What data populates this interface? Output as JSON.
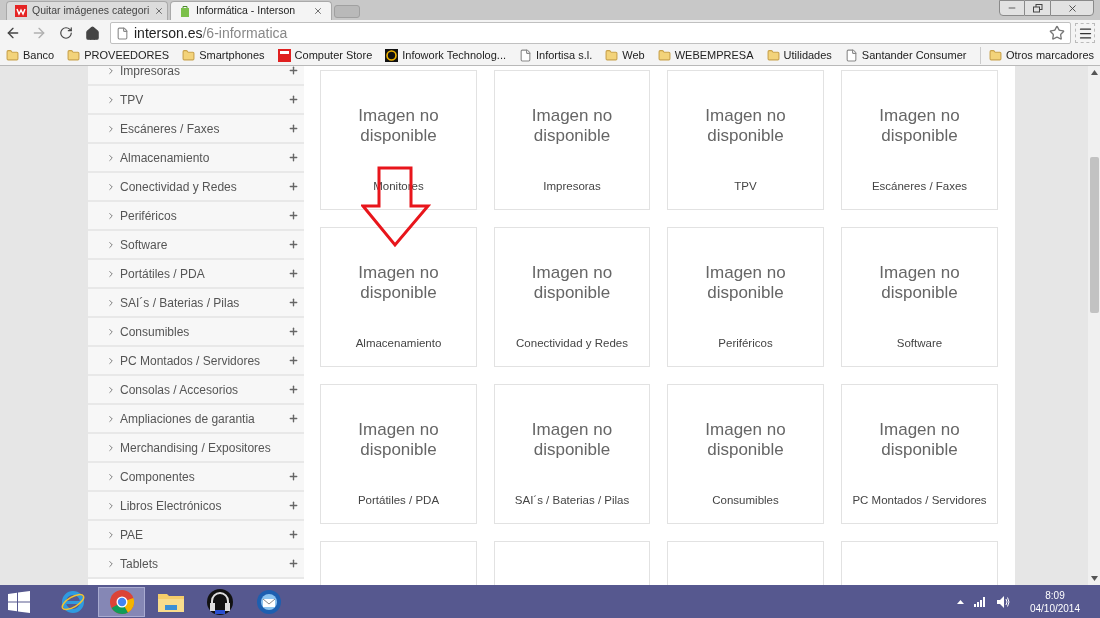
{
  "browser": {
    "tabs": [
      {
        "title": "Quitar imágenes categori",
        "selected": false,
        "kind": "red"
      },
      {
        "title": "Informática - Interson",
        "selected": true,
        "kind": "green"
      }
    ],
    "address": {
      "host": "interson.es",
      "path": "/6-informatica"
    },
    "bookmarks": [
      {
        "label": "Banco",
        "kind": "folder"
      },
      {
        "label": "PROVEEDORES",
        "kind": "folder"
      },
      {
        "label": "Smartphones",
        "kind": "folder"
      },
      {
        "label": "Computer Store",
        "kind": "red-logo"
      },
      {
        "label": "Infowork Technolog...",
        "kind": "round-logo"
      },
      {
        "label": "Infortisa s.l.",
        "kind": "page"
      },
      {
        "label": "Web",
        "kind": "folder"
      },
      {
        "label": "WEBEMPRESA",
        "kind": "folder"
      },
      {
        "label": "Utilidades",
        "kind": "folder"
      },
      {
        "label": "Santander Consumer",
        "kind": "page"
      }
    ],
    "other_bookmarks": "Otros marcadores"
  },
  "sidebar": {
    "items": [
      {
        "label": "Impresoras",
        "expandable": true
      },
      {
        "label": "TPV",
        "expandable": true
      },
      {
        "label": "Escáneres / Faxes",
        "expandable": true
      },
      {
        "label": "Almacenamiento",
        "expandable": true
      },
      {
        "label": "Conectividad y Redes",
        "expandable": true
      },
      {
        "label": "Periféricos",
        "expandable": true
      },
      {
        "label": "Software",
        "expandable": true
      },
      {
        "label": "Portátiles / PDA",
        "expandable": true
      },
      {
        "label": "SAI´s / Baterias / Pilas",
        "expandable": true
      },
      {
        "label": "Consumibles",
        "expandable": true
      },
      {
        "label": "PC Montados / Servidores",
        "expandable": true
      },
      {
        "label": "Consolas / Accesorios",
        "expandable": true
      },
      {
        "label": "Ampliaciones de garantia",
        "expandable": true
      },
      {
        "label": "Merchandising / Expositores",
        "expandable": false
      },
      {
        "label": "Componentes",
        "expandable": true
      },
      {
        "label": "Libros Electrónicos",
        "expandable": true
      },
      {
        "label": "PAE",
        "expandable": true
      },
      {
        "label": "Tablets",
        "expandable": true
      }
    ]
  },
  "grid": {
    "cards": [
      {
        "kind": "category",
        "image_text": "Imagen no disponible",
        "label": "Monitores"
      },
      {
        "kind": "category",
        "image_text": "Imagen no disponible",
        "label": "Impresoras"
      },
      {
        "kind": "category",
        "image_text": "Imagen no disponible",
        "label": "TPV"
      },
      {
        "kind": "category",
        "image_text": "Imagen no disponible",
        "label": "Escáneres / Faxes"
      },
      {
        "kind": "category",
        "image_text": "Imagen no disponible",
        "label": "Almacenamiento"
      },
      {
        "kind": "category",
        "image_text": "Imagen no disponible",
        "label": "Conectividad y Redes"
      },
      {
        "kind": "category",
        "image_text": "Imagen no disponible",
        "label": "Periféricos"
      },
      {
        "kind": "category",
        "image_text": "Imagen no disponible",
        "label": "Software"
      },
      {
        "kind": "category",
        "image_text": "Imagen no disponible",
        "label": "Portátiles / PDA"
      },
      {
        "kind": "category",
        "image_text": "Imagen no disponible",
        "label": "SAI´s / Baterias / Pilas"
      },
      {
        "kind": "category",
        "image_text": "Imagen no disponible",
        "label": "Consumibles"
      },
      {
        "kind": "category",
        "image_text": "Imagen no disponible",
        "label": "PC Montados / Servidores"
      },
      {
        "kind": "cut"
      },
      {
        "kind": "cut"
      },
      {
        "kind": "cut"
      },
      {
        "kind": "cut"
      }
    ]
  },
  "taskbar": {
    "apps": [
      {
        "kind": "ie",
        "selected": false
      },
      {
        "kind": "chrome",
        "selected": true
      },
      {
        "kind": "explorer",
        "selected": false
      },
      {
        "kind": "headphones",
        "selected": false
      },
      {
        "kind": "mail",
        "selected": false
      }
    ],
    "time": "8:09",
    "date": "04/10/2014"
  }
}
